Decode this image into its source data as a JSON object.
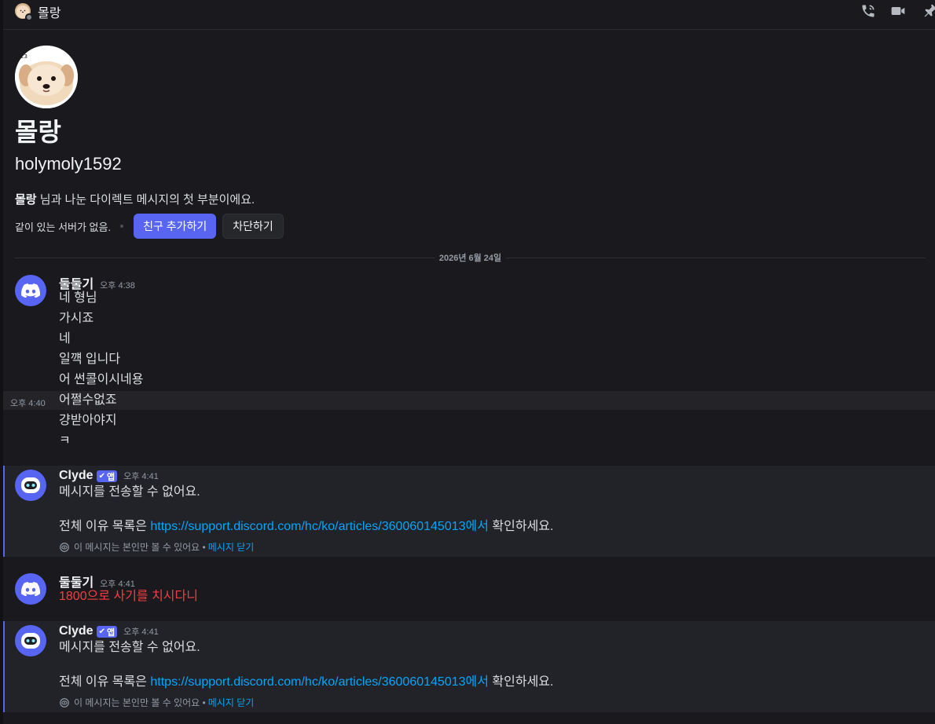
{
  "header": {
    "title": "몰랑",
    "icons": [
      "phone-call-icon",
      "video-call-icon",
      "pin-icon"
    ]
  },
  "intro": {
    "display_name": "몰랑",
    "username": "holymoly1592",
    "desc_name": "몰랑",
    "desc_rest": " 님과 나눈 다이렉트 메시지의 첫 부분이에요.",
    "mutual_servers": "같이 있는 서버가 없음.",
    "add_friend_label": "친구 추가하기",
    "block_label": "차단하기",
    "avatar_badge": "23"
  },
  "date_divider": "2026년 6월 24일",
  "messages": {
    "group1": {
      "author": "둘둘기",
      "timestamp": "오후 4:38",
      "lines": [
        "네 형님",
        "가시죠",
        "네",
        "일꺡 입니다",
        "어 썬콜이시네용",
        "어쩔수없죠",
        "걍받아야지",
        "ㅋ"
      ],
      "hover_timestamp": "오후 4:40"
    },
    "clyde1": {
      "author": "Clyde",
      "badge": "앱",
      "timestamp": "오후 4:41",
      "line1": "메시지를 전송할 수 없어요.",
      "line2_prefix": "전체 이유 목록은 ",
      "link": "https://support.discord.com/hc/ko/articles/360060145013에서",
      "line2_suffix": " 확인하세요.",
      "note": "이 메시지는 본인만 볼 수 있어요 •",
      "dismiss": "메시지 닫기"
    },
    "group2": {
      "author": "둘둘기",
      "timestamp": "오후 4:41",
      "line": "1800으로 사기를 치시다니"
    },
    "clyde2": {
      "author": "Clyde",
      "badge": "앱",
      "timestamp": "오후 4:41",
      "line1": "메시지를 전송할 수 없어요.",
      "line2_prefix": "전체 이유 목록은 ",
      "link": "https://support.discord.com/hc/ko/articles/360060145013에서",
      "line2_suffix": " 확인하세요.",
      "note": "이 메시지는 본인만 볼 수 있어요 •",
      "dismiss": "메시지 닫기"
    }
  },
  "colors": {
    "background": "#1a1a1e",
    "accent": "#5865f2",
    "link": "#00a8fc",
    "error_text": "#f23f43"
  }
}
